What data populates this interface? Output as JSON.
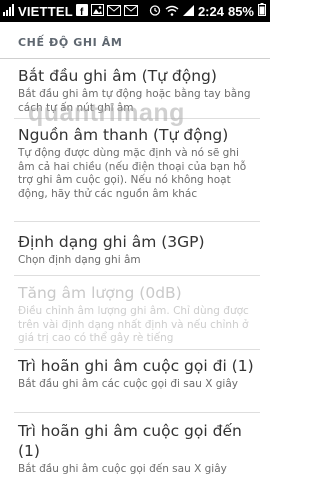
{
  "status_bar": {
    "carrier": "VIETTEL",
    "time": "2:24",
    "battery": "85%",
    "icons": [
      "signal-icon",
      "facebook-icon",
      "image-icon",
      "mail-icon",
      "mail-icon",
      "alarm-clock-icon",
      "wifi-icon",
      "signal-icon",
      "battery-icon"
    ]
  },
  "section_header": "CHẾ ĐỘ GHI ÂM",
  "watermark": "quantrimang",
  "items": [
    {
      "title": "Bắt đầu ghi âm (Tự động)",
      "summary": "Bắt đầu ghi âm tự động hoặc bằng tay bằng cách tự ấn nút ghi âm",
      "enabled": true
    },
    {
      "title": "Nguồn âm thanh (Tự động)",
      "summary": "Tự động được dùng mặc định và nó sẽ ghi âm cả hai chiều (nếu điện thoại của bạn hỗ trợ ghi âm cuộc gọi). Nếu nó không hoạt động, hãy thử các nguồn âm khác",
      "enabled": true
    },
    {
      "title": "Định dạng ghi âm (3GP)",
      "summary": "Chọn định dạng ghi âm",
      "enabled": true
    },
    {
      "title": "Tăng âm lượng (0dB)",
      "summary": "Điều chỉnh âm lượng ghi âm. Chỉ dùng được trên vài định dạng nhất định và nếu chỉnh ở giá trị cao có thể gây rè tiếng",
      "enabled": false
    },
    {
      "title": "Trì hoãn ghi âm cuộc gọi đi (1)",
      "summary": "Bắt đầu ghi âm các cuộc gọi đi sau X giây",
      "enabled": true
    },
    {
      "title": "Trì hoãn ghi âm cuộc gọi đến (1)",
      "summary": "Bắt đầu ghi âm cuộc gọi đến sau X giây",
      "enabled": true
    }
  ]
}
